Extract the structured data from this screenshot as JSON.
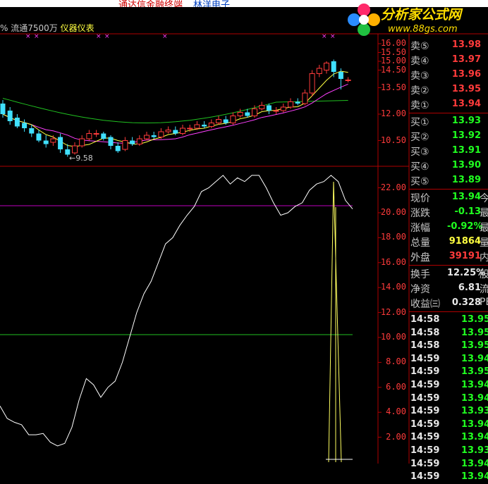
{
  "title_strip": {
    "left_text": "通达信金融终端",
    "right_text": "林洋电子"
  },
  "info_line": {
    "prefix": "% 流通7500万",
    "sector": "仪器仪表"
  },
  "logo": {
    "title": "分析家公式网",
    "url": "www.88gs.com"
  },
  "kline": {
    "low_marker": "←9.58",
    "axis_labels": [
      "16.00",
      "15.50",
      "15.00",
      "14.50",
      "13.50",
      "12.00",
      "10.50"
    ],
    "candles": [
      {
        "o": 12.6,
        "c": 12.0,
        "h": 12.8,
        "l": 11.8
      },
      {
        "o": 12.2,
        "c": 11.6,
        "h": 12.4,
        "l": 11.4
      },
      {
        "o": 11.8,
        "c": 11.3,
        "h": 12.0,
        "l": 11.2
      },
      {
        "o": 11.5,
        "c": 11.2,
        "h": 11.7,
        "l": 11.0
      },
      {
        "o": 11.2,
        "c": 10.9,
        "h": 11.4,
        "l": 10.7
      },
      {
        "o": 10.9,
        "c": 10.5,
        "h": 11.1,
        "l": 10.4
      },
      {
        "o": 10.5,
        "c": 10.3,
        "h": 10.8,
        "l": 10.1
      },
      {
        "o": 10.4,
        "c": 10.6,
        "h": 10.8,
        "l": 10.2
      },
      {
        "o": 10.7,
        "c": 10.0,
        "h": 10.9,
        "l": 9.8
      },
      {
        "o": 10.0,
        "c": 9.7,
        "h": 10.3,
        "l": 9.58
      },
      {
        "o": 9.8,
        "c": 10.2,
        "h": 10.4,
        "l": 9.7
      },
      {
        "o": 10.2,
        "c": 10.6,
        "h": 10.8,
        "l": 10.1
      },
      {
        "o": 10.6,
        "c": 10.9,
        "h": 11.1,
        "l": 10.5
      },
      {
        "o": 10.9,
        "c": 10.9,
        "h": 11.1,
        "l": 10.7
      },
      {
        "o": 10.9,
        "c": 10.6,
        "h": 11.0,
        "l": 10.5
      },
      {
        "o": 10.7,
        "c": 10.2,
        "h": 10.8,
        "l": 10.0
      },
      {
        "o": 10.2,
        "c": 9.9,
        "h": 10.4,
        "l": 9.8
      },
      {
        "o": 10.0,
        "c": 10.5,
        "h": 10.7,
        "l": 9.9
      },
      {
        "o": 10.5,
        "c": 10.3,
        "h": 10.7,
        "l": 10.2
      },
      {
        "o": 10.3,
        "c": 10.6,
        "h": 10.8,
        "l": 10.2
      },
      {
        "o": 10.6,
        "c": 10.8,
        "h": 11.0,
        "l": 10.5
      },
      {
        "o": 10.8,
        "c": 10.7,
        "h": 11.0,
        "l": 10.6
      },
      {
        "o": 10.7,
        "c": 11.0,
        "h": 11.2,
        "l": 10.6
      },
      {
        "o": 11.0,
        "c": 11.1,
        "h": 11.3,
        "l": 10.9
      },
      {
        "o": 11.1,
        "c": 10.9,
        "h": 11.3,
        "l": 10.8
      },
      {
        "o": 10.9,
        "c": 11.2,
        "h": 11.4,
        "l": 10.8
      },
      {
        "o": 11.2,
        "c": 11.2,
        "h": 11.4,
        "l": 11.0
      },
      {
        "o": 11.2,
        "c": 11.4,
        "h": 11.6,
        "l": 11.1
      },
      {
        "o": 11.4,
        "c": 11.3,
        "h": 11.6,
        "l": 11.2
      },
      {
        "o": 11.3,
        "c": 11.5,
        "h": 11.7,
        "l": 11.2
      },
      {
        "o": 11.5,
        "c": 11.7,
        "h": 11.9,
        "l": 11.4
      },
      {
        "o": 11.7,
        "c": 11.5,
        "h": 11.9,
        "l": 11.4
      },
      {
        "o": 11.5,
        "c": 11.9,
        "h": 12.1,
        "l": 11.4
      },
      {
        "o": 11.9,
        "c": 12.1,
        "h": 12.3,
        "l": 11.8
      },
      {
        "o": 12.1,
        "c": 11.9,
        "h": 12.3,
        "l": 11.8
      },
      {
        "o": 11.9,
        "c": 12.3,
        "h": 12.5,
        "l": 11.8
      },
      {
        "o": 12.3,
        "c": 12.5,
        "h": 12.7,
        "l": 12.2
      },
      {
        "o": 12.5,
        "c": 12.2,
        "h": 12.6,
        "l": 12.0
      },
      {
        "o": 12.2,
        "c": 12.2,
        "h": 12.4,
        "l": 12.0
      },
      {
        "o": 12.2,
        "c": 12.4,
        "h": 12.6,
        "l": 12.1
      },
      {
        "o": 12.4,
        "c": 12.7,
        "h": 12.9,
        "l": 12.3
      },
      {
        "o": 12.7,
        "c": 12.6,
        "h": 12.9,
        "l": 12.5
      },
      {
        "o": 12.6,
        "c": 13.2,
        "h": 13.4,
        "l": 12.5
      },
      {
        "o": 13.2,
        "c": 14.3,
        "h": 14.5,
        "l": 13.0
      },
      {
        "o": 14.3,
        "c": 14.6,
        "h": 14.8,
        "l": 14.1
      },
      {
        "o": 14.5,
        "c": 14.9,
        "h": 15.0,
        "l": 14.3
      },
      {
        "o": 15.0,
        "c": 14.4,
        "h": 15.1,
        "l": 14.1
      },
      {
        "o": 14.4,
        "c": 14.0,
        "h": 14.6,
        "l": 13.4
      },
      {
        "o": 13.9,
        "c": 13.94,
        "h": 14.1,
        "l": 13.8
      }
    ]
  },
  "indicator": {
    "axis_labels": [
      "22.00",
      "20.00",
      "18.00",
      "16.00",
      "14.00",
      "12.00",
      "10.00",
      "8.00",
      "6.00",
      "4.00",
      "2.00"
    ]
  },
  "quote": {
    "asks": [
      {
        "label": "卖⑤",
        "price": "13.98",
        "color": "#ff3b3b"
      },
      {
        "label": "卖④",
        "price": "13.97",
        "color": "#ff3b3b"
      },
      {
        "label": "卖③",
        "price": "13.96",
        "color": "#ff3b3b"
      },
      {
        "label": "卖②",
        "price": "13.95",
        "color": "#ff3b3b"
      },
      {
        "label": "卖①",
        "price": "13.94",
        "color": "#ff3b3b"
      }
    ],
    "bids": [
      {
        "label": "买①",
        "price": "13.93",
        "color": "#20ff20"
      },
      {
        "label": "买②",
        "price": "13.92",
        "color": "#20ff20"
      },
      {
        "label": "买③",
        "price": "13.91",
        "color": "#20ff20"
      },
      {
        "label": "买④",
        "price": "13.90",
        "color": "#20ff20"
      },
      {
        "label": "买⑤",
        "price": "13.89",
        "color": "#20ff20"
      }
    ],
    "stats": [
      {
        "label": "现价",
        "value": "13.94",
        "color": "#20ff20",
        "suffix": "今"
      },
      {
        "label": "涨跌",
        "value": "-0.13",
        "color": "#20ff20",
        "suffix": "最"
      },
      {
        "label": "涨幅",
        "value": "-0.92%",
        "color": "#20ff20",
        "suffix": "最"
      },
      {
        "label": "总量",
        "value": "91864",
        "color": "#ffff40",
        "suffix": "量"
      },
      {
        "label": "外盘",
        "value": "39191",
        "color": "#ff3b3b",
        "suffix": "内"
      }
    ],
    "fundamentals": [
      {
        "label": "换手",
        "value": "12.25%",
        "color": "#e8e8e8",
        "suffix": "股"
      },
      {
        "label": "净资",
        "value": "6.81",
        "color": "#e8e8e8",
        "suffix": "流"
      },
      {
        "label": "收益㈢",
        "value": "0.328",
        "color": "#e8e8e8",
        "suffix": "PE"
      }
    ]
  },
  "ticks": [
    {
      "time": "14:58",
      "price": "13.95"
    },
    {
      "time": "14:58",
      "price": "13.95"
    },
    {
      "time": "14:58",
      "price": "13.95"
    },
    {
      "time": "14:59",
      "price": "13.94"
    },
    {
      "time": "14:59",
      "price": "13.95"
    },
    {
      "time": "14:59",
      "price": "13.94"
    },
    {
      "time": "14:59",
      "price": "13.94"
    },
    {
      "time": "14:59",
      "price": "13.93"
    },
    {
      "time": "14:59",
      "price": "13.94"
    },
    {
      "time": "14:59",
      "price": "13.94"
    },
    {
      "time": "14:59",
      "price": "13.93"
    },
    {
      "time": "14:59",
      "price": "13.94"
    },
    {
      "time": "14:59",
      "price": "13.94"
    }
  ]
}
